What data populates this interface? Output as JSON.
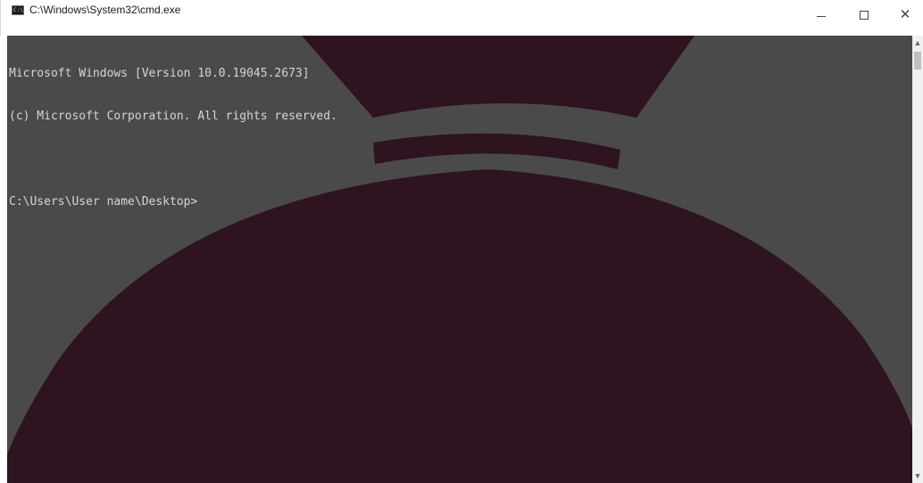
{
  "window": {
    "title": "C:\\Windows\\System32\\cmd.exe",
    "app_icon_text": "C:\\",
    "icon": "cmd-icon"
  },
  "controls": {
    "minimize_icon": "minimize-icon",
    "maximize_icon": "maximize-icon",
    "close_icon": "close-icon",
    "close_glyph": "✕"
  },
  "console": {
    "lines": [
      "Microsoft Windows [Version 10.0.19045.2673]",
      "(c) Microsoft Corporation. All rights reserved.",
      "",
      "C:\\Users\\User name\\Desktop>"
    ],
    "background_color": "#4a4a4a",
    "overlay_color": "#2e1320",
    "text_color": "#d6d6d6"
  },
  "scrollbar": {
    "up_glyph": "▲",
    "down_glyph": "▼"
  }
}
